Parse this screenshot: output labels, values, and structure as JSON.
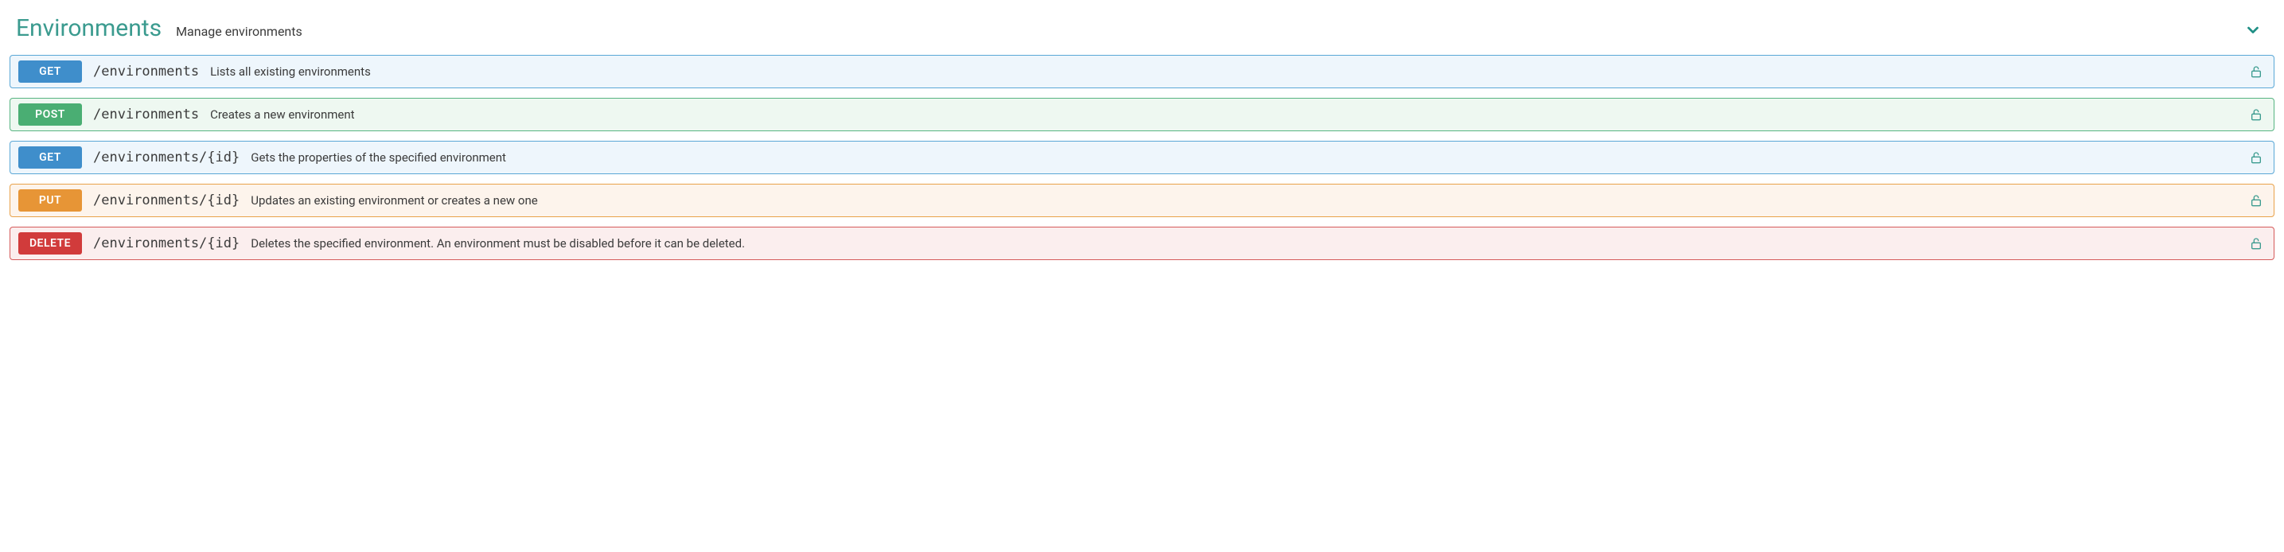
{
  "section": {
    "title": "Environments",
    "subtitle": "Manage environments"
  },
  "operations": [
    {
      "method": "GET",
      "path": "/environments",
      "desc": "Lists all existing environments",
      "style": "m-get"
    },
    {
      "method": "POST",
      "path": "/environments",
      "desc": "Creates a new environment",
      "style": "m-post"
    },
    {
      "method": "GET",
      "path": "/environments/{id}",
      "desc": "Gets the properties of the specified environment",
      "style": "m-get"
    },
    {
      "method": "PUT",
      "path": "/environments/{id}",
      "desc": "Updates an existing environment or creates a new one",
      "style": "m-put"
    },
    {
      "method": "DELETE",
      "path": "/environments/{id}",
      "desc": "Deletes the specified environment. An environment must be disabled before it can be deleted.",
      "style": "m-delete"
    }
  ],
  "colors": {
    "lock_unlocked": "#3b9b8f",
    "chevron": "#1f8f85"
  }
}
